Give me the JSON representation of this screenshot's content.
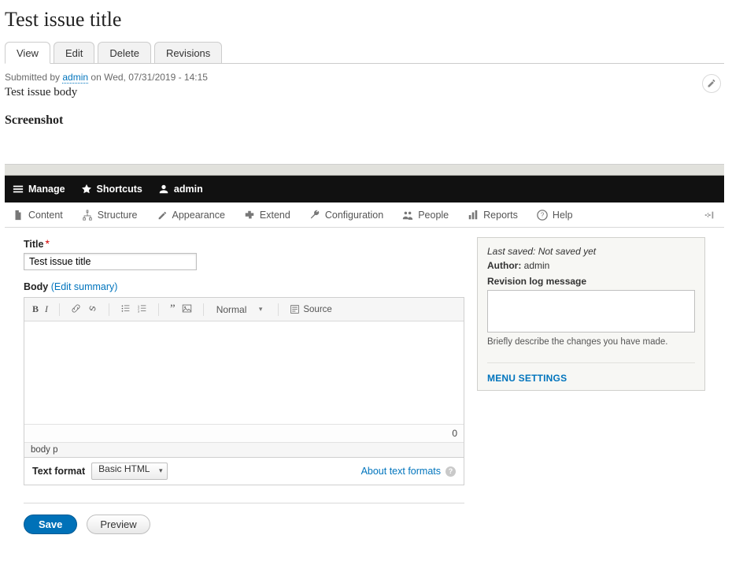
{
  "page": {
    "title": "Test issue title",
    "submitted_prefix": "Submitted by ",
    "submitted_user": "admin",
    "submitted_suffix": " on Wed, 07/31/2019 - 14:15",
    "body_text": "Test issue body",
    "screenshot_heading": "Screenshot"
  },
  "tabs": {
    "items": [
      {
        "label": "View",
        "active": true
      },
      {
        "label": "Edit",
        "active": false
      },
      {
        "label": "Delete",
        "active": false
      },
      {
        "label": "Revisions",
        "active": false
      }
    ]
  },
  "toolbar_black": {
    "manage": "Manage",
    "shortcuts": "Shortcuts",
    "user": "admin"
  },
  "admin_tabs": {
    "items": [
      {
        "key": "content",
        "label": "Content"
      },
      {
        "key": "structure",
        "label": "Structure"
      },
      {
        "key": "appearance",
        "label": "Appearance"
      },
      {
        "key": "extend",
        "label": "Extend"
      },
      {
        "key": "configuration",
        "label": "Configuration"
      },
      {
        "key": "people",
        "label": "People"
      },
      {
        "key": "reports",
        "label": "Reports"
      },
      {
        "key": "help",
        "label": "Help"
      }
    ]
  },
  "form": {
    "title_label": "Title",
    "title_value": "Test issue title",
    "body_label": "Body",
    "edit_summary": "(Edit summary)",
    "char_count": "0",
    "ck_path": "body  p",
    "ck_normal": "Normal",
    "ck_source": "Source",
    "text_format_label": "Text format",
    "text_format_value": "Basic HTML",
    "about_text_formats": "About text formats",
    "save": "Save",
    "preview": "Preview"
  },
  "side": {
    "last_saved_label": "Last saved:",
    "last_saved_value": "Not saved yet",
    "author_label": "Author:",
    "author_value": "admin",
    "revision_label": "Revision log message",
    "revision_help": "Briefly describe the changes you have made.",
    "menu_settings": "MENU SETTINGS"
  }
}
